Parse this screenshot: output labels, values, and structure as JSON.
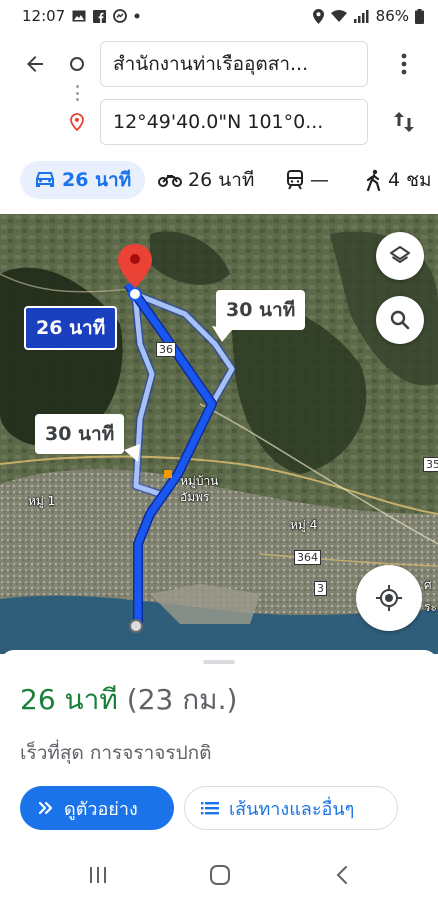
{
  "status_bar": {
    "time": "12:07",
    "battery": "86%",
    "left_icons": [
      "image-icon",
      "facebook-icon",
      "messenger-icon",
      "dot-icon"
    ],
    "right_icons": [
      "location-icon",
      "wifi-icon",
      "signal-icon",
      "battery-icon"
    ]
  },
  "search": {
    "origin": "สำนักงานท่าเรืออุตสา...",
    "destination": "12°49'40.0\"N 101°0..."
  },
  "modes": [
    {
      "name": "car",
      "label": "26 นาที",
      "active": true
    },
    {
      "name": "motorcycle",
      "label": "26 นาที",
      "active": false
    },
    {
      "name": "transit",
      "label": "—",
      "active": false
    },
    {
      "name": "walk",
      "label": "4 ชม",
      "active": false
    }
  ],
  "map": {
    "main_route_label": "26 นาที",
    "alt_route_label_1": "30 นาที",
    "alt_route_label_2": "30 นาที",
    "place_labels": [
      "หมู่บ้าน",
      "อัมพร",
      "หมู่ 1",
      "หมู่ 4"
    ],
    "road_shields": [
      "36",
      "364",
      "3",
      "35"
    ],
    "edge_labels": [
      "ศ",
      "ระ"
    ]
  },
  "summary": {
    "duration": "26 นาที",
    "distance": "(23 กม.)",
    "subtitle": "เร็วที่สุด การจราจรปกติ"
  },
  "actions": {
    "preview": "ดูตัวอย่าง",
    "steps": "เส้นทางและอื่นๆ"
  },
  "colors": {
    "accent": "#1a73e8",
    "duration_green": "#188038",
    "route_blue": "#1a3fbf",
    "alt_route": "#a8c1f5",
    "pin_red": "#ea4335"
  }
}
